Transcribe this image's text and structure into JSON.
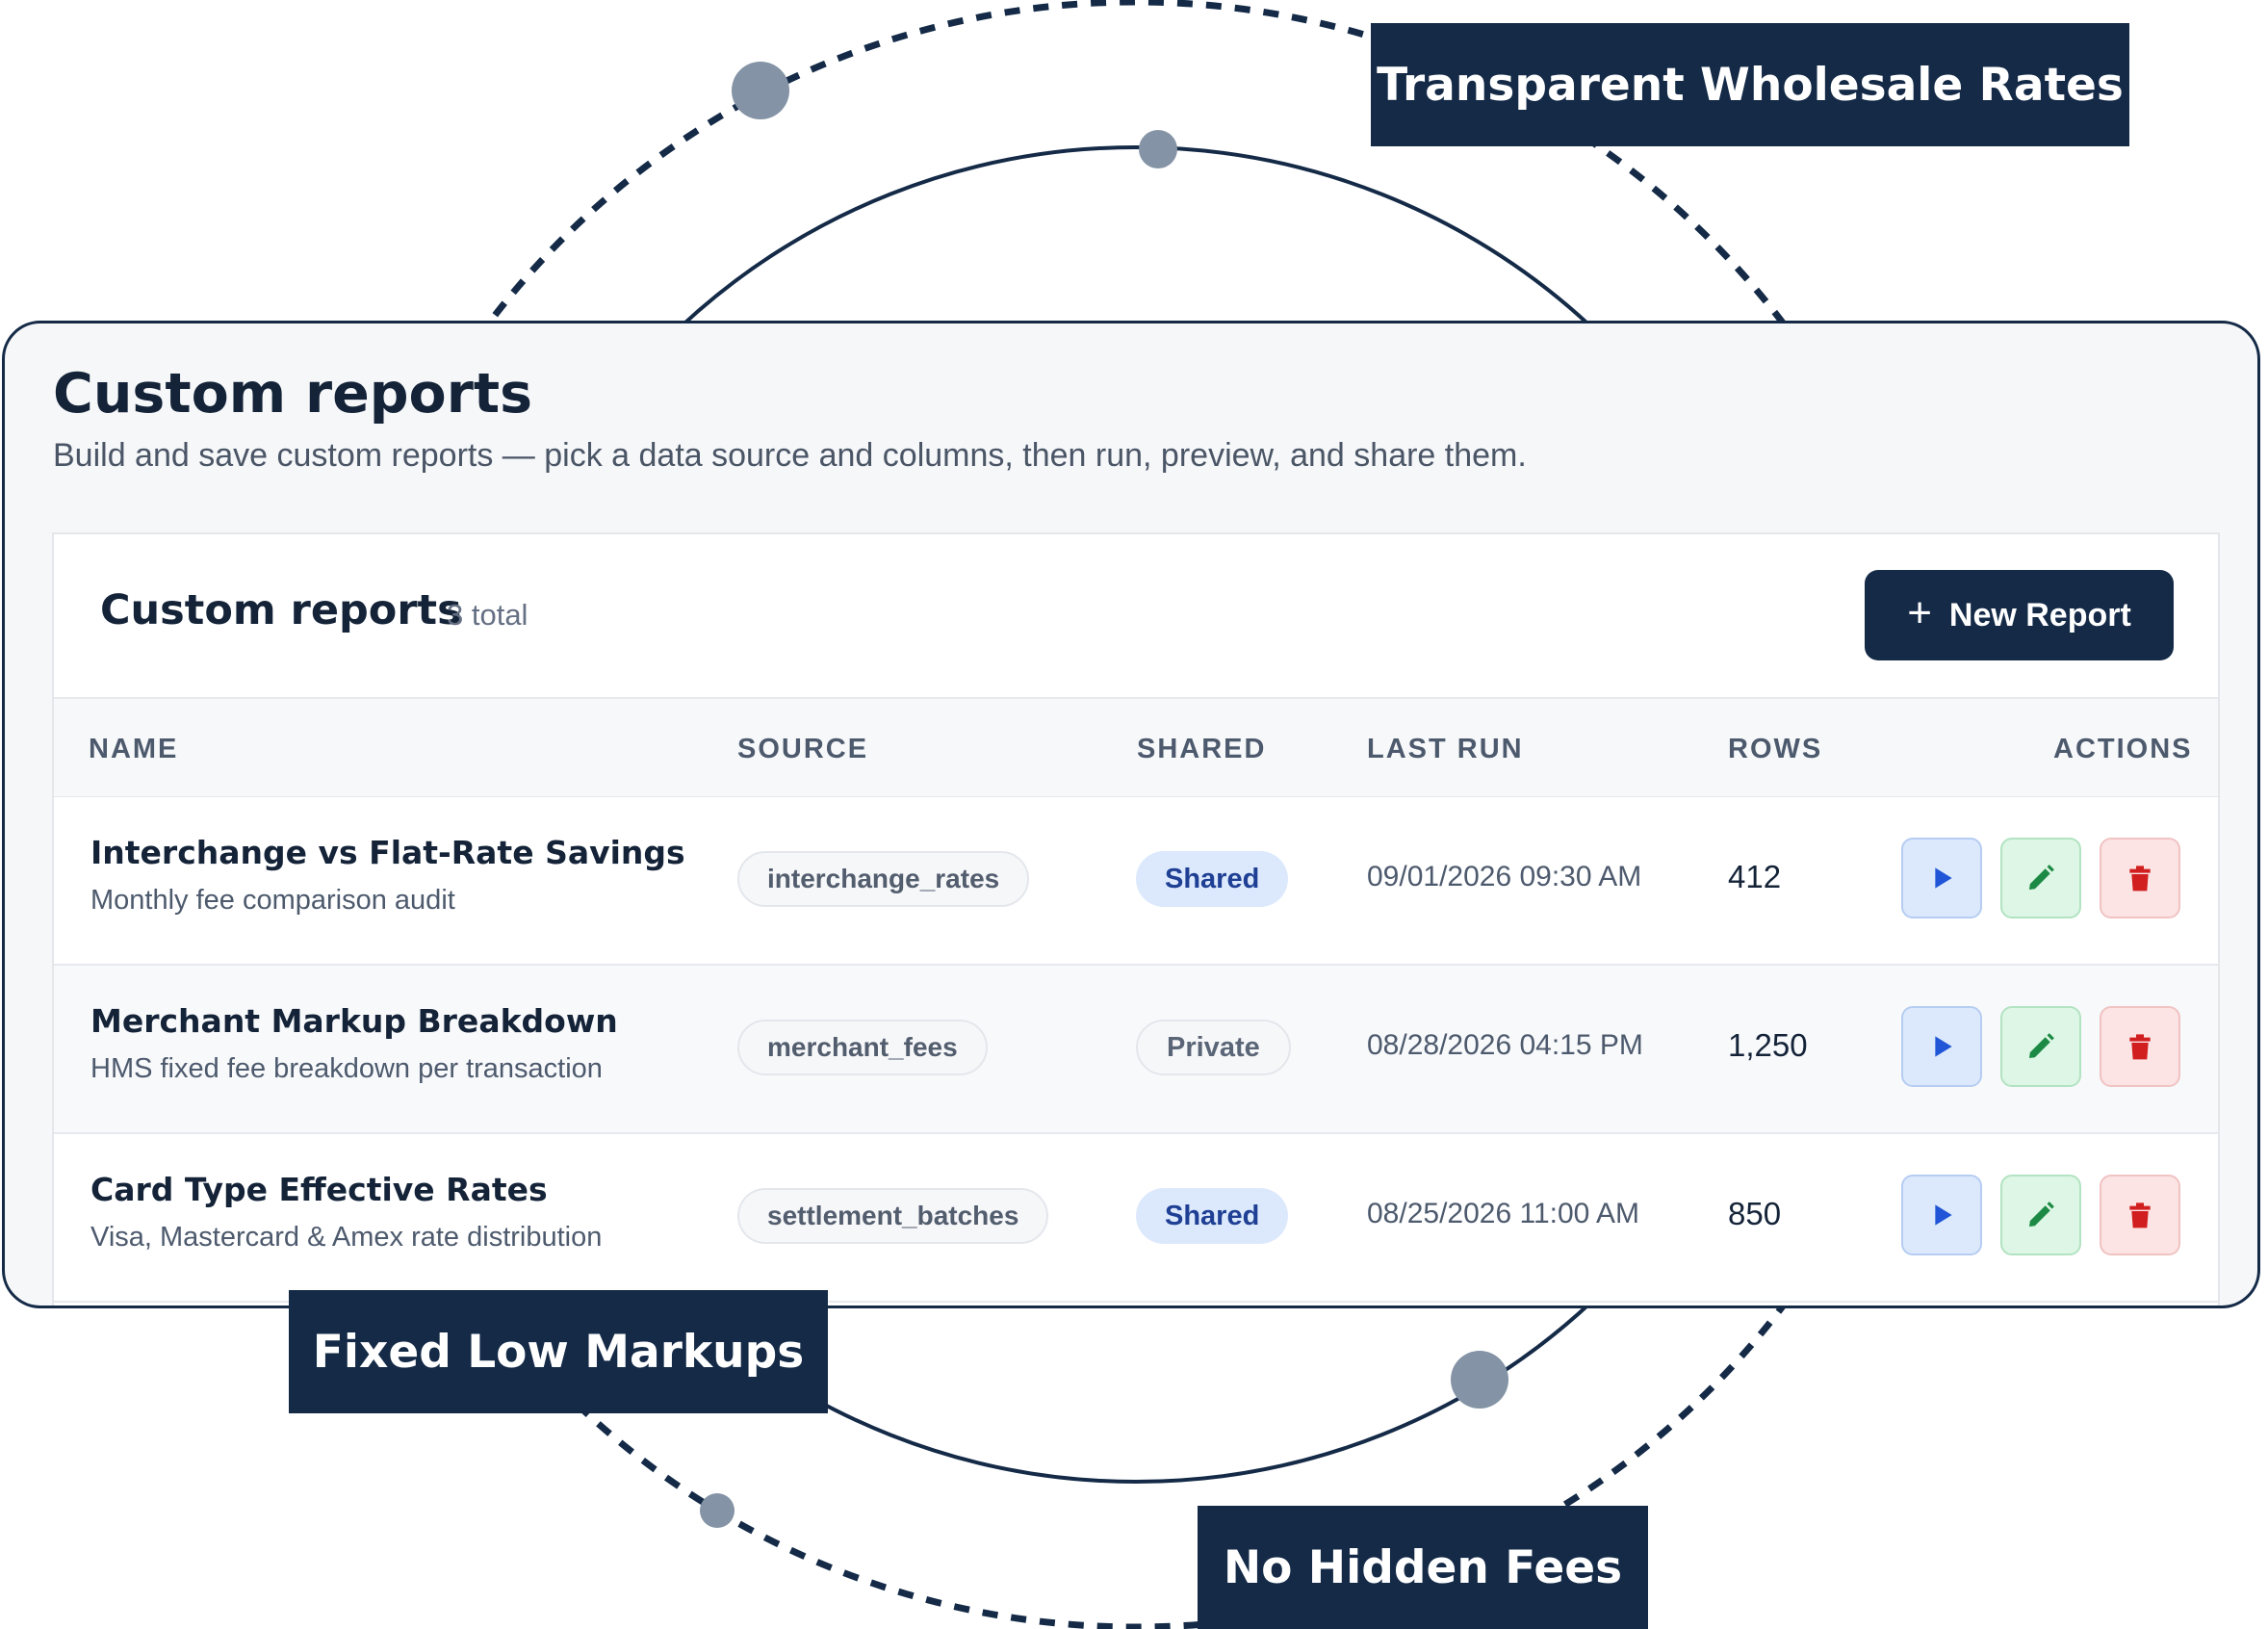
{
  "callouts": {
    "top": "Transparent Wholesale Rates",
    "left": "Fixed Low Markups",
    "bottom": "No Hidden Fees"
  },
  "page": {
    "title": "Custom reports",
    "subtitle": "Build and save custom reports — pick a data source and columns, then run, preview, and share them."
  },
  "panel": {
    "title": "Custom reports",
    "count": "3 total",
    "new_button": "New Report",
    "new_button_icon": "plus-icon"
  },
  "table": {
    "columns": [
      "NAME",
      "SOURCE",
      "SHARED",
      "LAST RUN",
      "ROWS",
      "ACTIONS"
    ],
    "rows": [
      {
        "name": "Interchange vs Flat-Rate Savings",
        "description": "Monthly fee comparison audit",
        "source": "interchange_rates",
        "shared": "Shared",
        "last_run": "09/01/2026 09:30 AM",
        "rows": "412"
      },
      {
        "name": "Merchant Markup Breakdown",
        "description": "HMS fixed fee breakdown per transaction",
        "source": "merchant_fees",
        "shared": "Private",
        "last_run": "08/28/2026 04:15 PM",
        "rows": "1,250"
      },
      {
        "name": "Card Type Effective Rates",
        "description": "Visa, Mastercard & Amex rate distribution",
        "source": "settlement_batches",
        "shared": "Shared",
        "last_run": "08/25/2026 11:00 AM",
        "rows": "850"
      }
    ],
    "action_icons": [
      "play-icon",
      "pencil-icon",
      "trash-icon"
    ]
  },
  "colors": {
    "navy": "#142a47",
    "dot": "#8493a5",
    "run": "#1f55d6",
    "edit": "#1c8a44",
    "delete": "#d11f1f"
  }
}
